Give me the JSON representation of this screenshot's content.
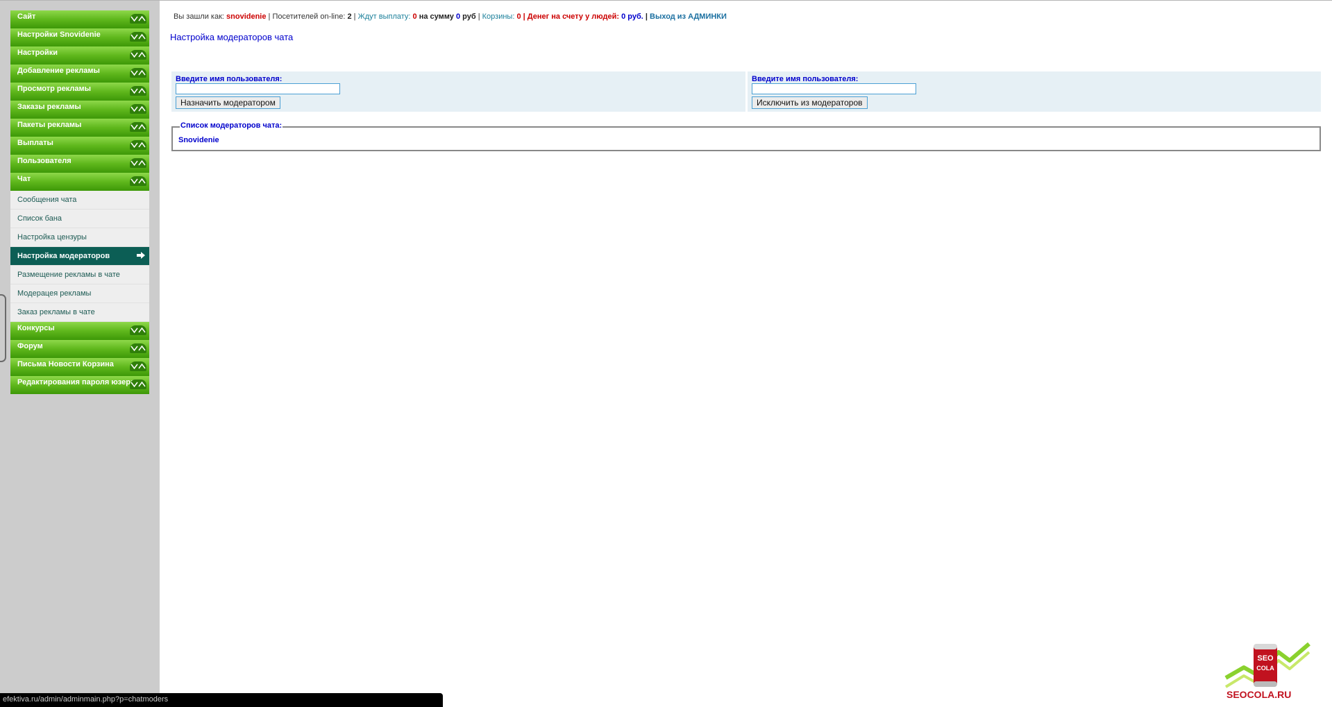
{
  "sidebar": {
    "categories_top": [
      {
        "label": "Сайт"
      },
      {
        "label": "Настройки Snovidenie"
      },
      {
        "label": "Настройки"
      },
      {
        "label": "Добавление рекламы"
      },
      {
        "label": "Просмотр рекламы"
      },
      {
        "label": "Заказы рекламы"
      },
      {
        "label": "Пакеты рекламы"
      },
      {
        "label": "Выплаты"
      },
      {
        "label": "Пользователя"
      },
      {
        "label": "Чат"
      }
    ],
    "chat_items": [
      {
        "label": "Сообщения чата"
      },
      {
        "label": "Список бана"
      },
      {
        "label": "Настройка цензуры"
      },
      {
        "label": "Настройка модераторов",
        "active": true
      },
      {
        "label": "Размещение рекламы в чате"
      },
      {
        "label": "Модерацея рекламы"
      },
      {
        "label": "Заказ рекламы в чате"
      }
    ],
    "categories_bottom": [
      {
        "label": "Конкурсы"
      },
      {
        "label": "Форум"
      },
      {
        "label": "Письма Новости Корзина"
      },
      {
        "label": "Редактирования пароля юзера"
      }
    ]
  },
  "status": {
    "logged_as_label": "Вы зашли как:",
    "user": "snovidenie",
    "sep1": "|",
    "online_label": "Посетителей on-line:",
    "online_count": "2",
    "sep2": "|",
    "wait_label": "Ждут выплату:",
    "wait_count": "0",
    "sum_label": "на сумму",
    "sum_value": "0",
    "sum_unit": "руб",
    "sep3": "|",
    "carts_label": "Корзины:",
    "carts_count": "0",
    "money_label": "| Денег на счету у людей:",
    "money_value": "0 руб.",
    "sep4": "|",
    "logout": "Выход из АДМИНКИ"
  },
  "page": {
    "title": "Настройка модераторов чата"
  },
  "forms": {
    "assign": {
      "label": "Введите имя пользователя:",
      "value": "",
      "button": "Назначить модератором"
    },
    "remove": {
      "label": "Введите имя пользователя:",
      "value": "",
      "button": "Исключить из модераторов"
    }
  },
  "moderators": {
    "legend": "Список модераторов чата:",
    "items": [
      "Snovidenie"
    ]
  },
  "browser_status": {
    "url": "efektiva.ru/admin/adminmain.php?p=chatmoders"
  },
  "logo": {
    "can_text_1": "SEO",
    "can_text_2": "COLA",
    "text": "SEOCOLA.RU"
  },
  "colors": {
    "menu_green": "#5fb71c",
    "active_item": "#0c5e55",
    "link_blue": "#0000cc",
    "highlight_red": "#cc0000"
  },
  "icons": {
    "category_toggle": "chevron-down-up-icon",
    "active_arrow": "arrow-right-icon"
  }
}
